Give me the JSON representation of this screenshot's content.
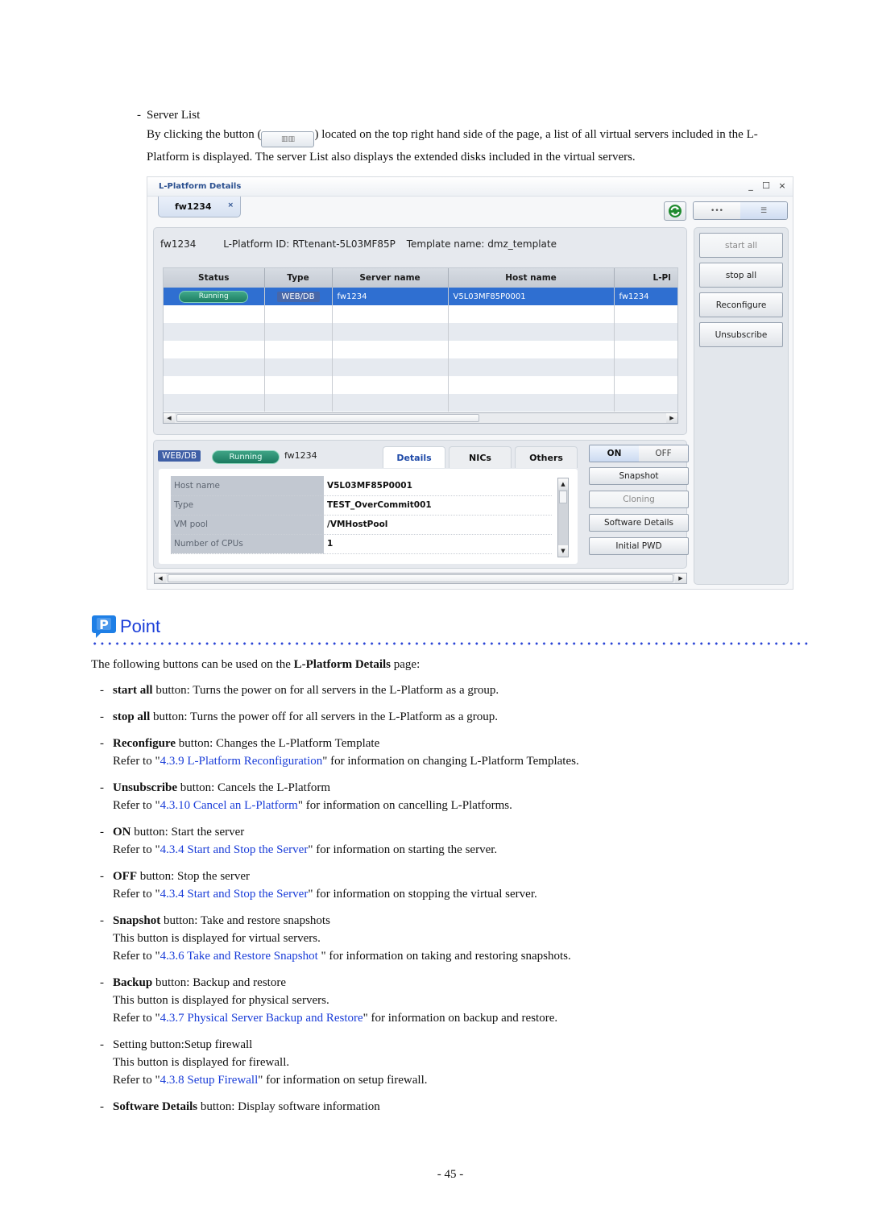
{
  "intro": {
    "bullet_title": "Server List",
    "line1_before": "By clicking the button (",
    "line1_after": ") located on the top right hand side of the page, a list of all virtual servers included in the L-",
    "line2": "Platform is displayed. The server List also displays the extended disks included in the virtual servers.",
    "inline_button_icon": "list-view-icon"
  },
  "window": {
    "title": "L-Platform Details",
    "controls": {
      "minimize": "_",
      "maximize": "☐",
      "close": "×"
    },
    "tab": {
      "label": "fw1234",
      "close": "×"
    },
    "refresh_icon": "refresh-icon",
    "view_toggle": {
      "left": "•••",
      "right": "☰"
    },
    "info": {
      "name": "fw1234",
      "platform_id": "L-Platform ID: RTtenant-5L03MF85P",
      "template": "Template name: dmz_template"
    },
    "grid": {
      "columns": [
        "Status",
        "Type",
        "Server name",
        "Host name",
        "L-Pl"
      ],
      "rows": [
        {
          "status": "Running",
          "type": "WEB/DB",
          "server_name": "fw1234",
          "host_name": "V5L03MF85P0001",
          "lplatform": "fw1234"
        }
      ],
      "empty_rows": 6
    },
    "actions": [
      "start all",
      "stop all",
      "Reconfigure",
      "Unsubscribe"
    ],
    "actions_disabled": [
      "start all"
    ],
    "detail": {
      "type_tag": "WEB/DB",
      "status_tag": "Running",
      "server_name": "fw1234",
      "tabs": [
        "Details",
        "NICs",
        "Others"
      ],
      "active_tab": "Details",
      "fields": [
        {
          "key": "Host name",
          "value": "V5L03MF85P0001"
        },
        {
          "key": "Type",
          "value": "TEST_OverCommit001"
        },
        {
          "key": "VM pool",
          "value": "/VMHostPool"
        },
        {
          "key": "Number of CPUs",
          "value": "1"
        }
      ],
      "power": {
        "on": "ON",
        "off": "OFF"
      },
      "buttons": [
        "Snapshot",
        "Cloning",
        "Software Details",
        "Initial PWD"
      ],
      "buttons_disabled": [
        "Cloning"
      ]
    }
  },
  "point": {
    "label": "Point",
    "icon": "point-p-icon",
    "accent_color": "#1a3dd8",
    "intro_before": "The following buttons can be used on the ",
    "intro_bold": "L-Platform Details",
    "intro_after": " page:",
    "items": [
      {
        "bold": "start all",
        "text": " button: Turns the power on for all servers in the L-Platform as a group."
      },
      {
        "bold": "stop all",
        "text": " button: Turns the power off for all servers in the L-Platform as a group."
      },
      {
        "bold": "Reconfigure",
        "text": " button: Changes the L-Platform Template",
        "sub": [
          {
            "pre": "Refer to \"",
            "link": "4.3.9 L-Platform Reconfiguration",
            "post": "\" for information on changing L-Platform Templates."
          }
        ]
      },
      {
        "bold": "Unsubscribe",
        "text": " button: Cancels the L-Platform",
        "sub": [
          {
            "pre": "Refer to \"",
            "link": "4.3.10 Cancel an L-Platform",
            "post": "\" for information on cancelling L-Platforms."
          }
        ]
      },
      {
        "bold": "ON",
        "text": " button: Start the server",
        "sub": [
          {
            "pre": "Refer to \"",
            "link": "4.3.4 Start and Stop the Server",
            "post": "\" for information on starting the server."
          }
        ]
      },
      {
        "bold": "OFF",
        "text": " button: Stop the server",
        "sub": [
          {
            "pre": "Refer to \"",
            "link": "4.3.4 Start and Stop the Server",
            "post": "\" for information on stopping the virtual server."
          }
        ]
      },
      {
        "bold": "Snapshot",
        "text": " button: Take and restore snapshots",
        "sub": [
          {
            "pre": "This button is displayed for virtual servers."
          },
          {
            "pre": "Refer to \"",
            "link": "4.3.6 Take and Restore Snapshot ",
            "post": "\" for information on taking and restoring snapshots."
          }
        ]
      },
      {
        "bold": "Backup",
        "text": " button: Backup and restore",
        "sub": [
          {
            "pre": "This button is displayed for physical servers."
          },
          {
            "pre": "Refer to \"",
            "link": "4.3.7 Physical Server Backup and Restore",
            "post": "\" for information on backup and restore."
          }
        ]
      },
      {
        "bold": "",
        "text": "Setting button:Setup firewall",
        "sub": [
          {
            "pre": "This button is displayed for firewall."
          },
          {
            "pre": "Refer to \"",
            "link": "4.3.8 Setup Firewall",
            "post": "\" for information on setup firewall."
          }
        ]
      },
      {
        "bold": "Software Details",
        "text": " button: Display software information"
      }
    ]
  },
  "footer": {
    "page_number": "- 45 -"
  }
}
